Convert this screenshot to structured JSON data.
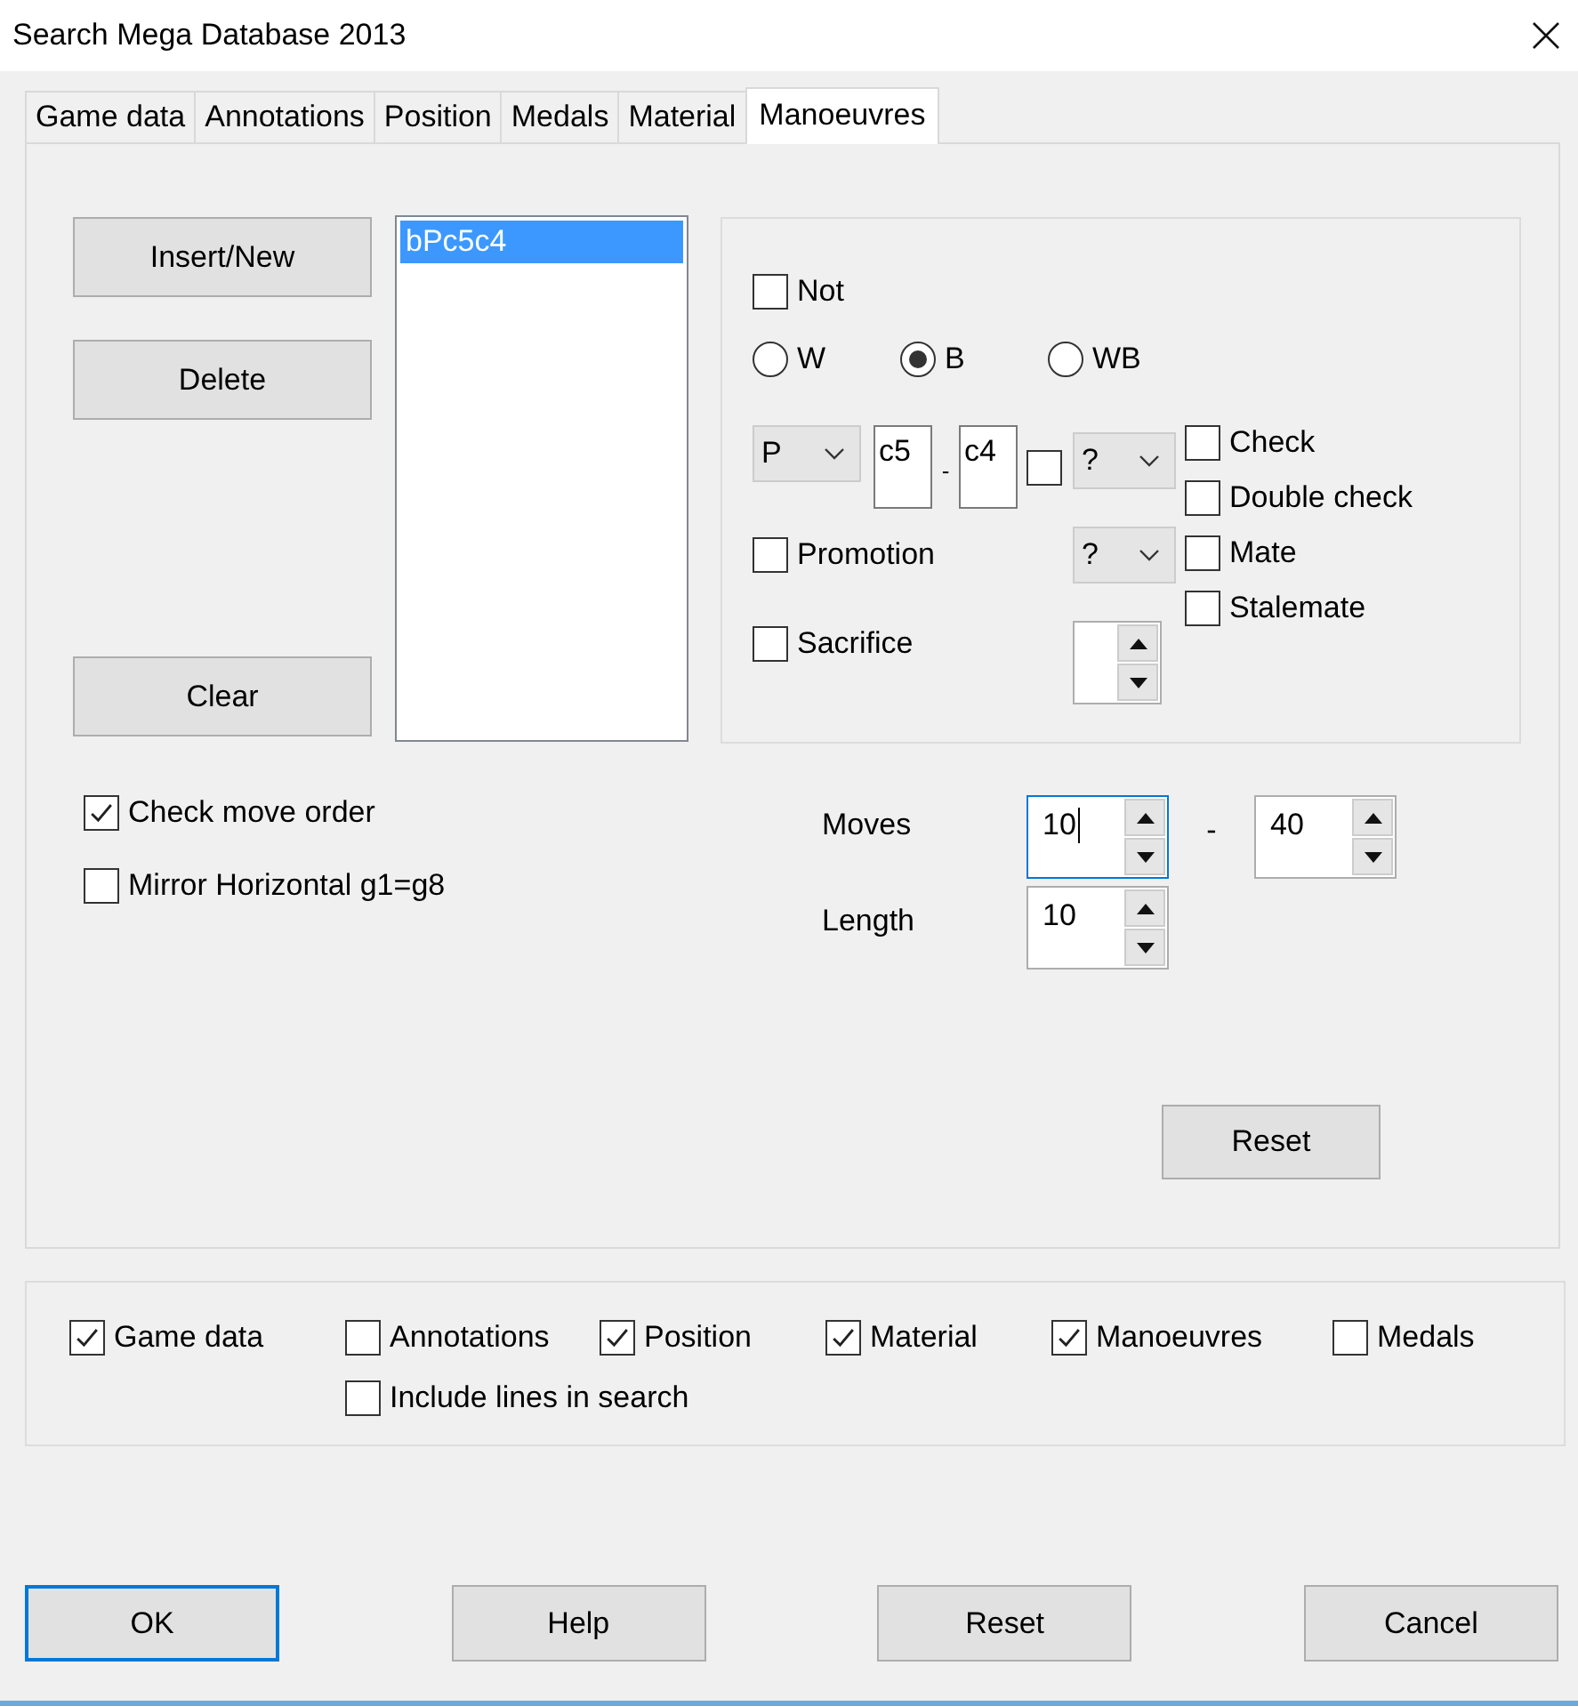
{
  "window": {
    "title": "Search Mega Database 2013"
  },
  "tabs": [
    {
      "label": "Game data",
      "selected": false
    },
    {
      "label": "Annotations",
      "selected": false
    },
    {
      "label": "Position",
      "selected": false
    },
    {
      "label": "Medals",
      "selected": false
    },
    {
      "label": "Material",
      "selected": false
    },
    {
      "label": "Manoeuvres",
      "selected": true
    }
  ],
  "manoeuvres": {
    "buttons": [
      "Insert/New",
      "Delete",
      "Clear"
    ],
    "list": [
      {
        "text": "bPc5c4",
        "selected": true
      }
    ],
    "criteria": {
      "not": {
        "label": "Not",
        "checked": false
      },
      "side": [
        {
          "label": "W",
          "selected": false
        },
        {
          "label": "B",
          "selected": true
        },
        {
          "label": "WB",
          "selected": false
        }
      ],
      "piece": "P",
      "from": "c5",
      "separator": "-",
      "to": "c4",
      "capture": {
        "checked": false,
        "value": "?"
      },
      "promotion": {
        "label": "Promotion",
        "checked": false,
        "value": "?"
      },
      "sacrifice": {
        "label": "Sacrifice",
        "checked": false
      },
      "checks": [
        {
          "label": "Check",
          "checked": false
        },
        {
          "label": "Double check",
          "checked": false
        },
        {
          "label": "Mate",
          "checked": false
        },
        {
          "label": "Stalemate",
          "checked": false
        }
      ]
    },
    "options": [
      {
        "label": "Check move order",
        "checked": true
      },
      {
        "label": "Mirror Horizontal g1=g8",
        "checked": false
      }
    ],
    "moves": {
      "label": "Moves",
      "from": "10",
      "from_focused": true,
      "separator": "-",
      "to": "40"
    },
    "length": {
      "label": "Length",
      "value": "10"
    },
    "reset": "Reset"
  },
  "search_in": [
    {
      "label": "Game data",
      "checked": true
    },
    {
      "label": "Annotations",
      "checked": false
    },
    {
      "label": "Position",
      "checked": true
    },
    {
      "label": "Material",
      "checked": true
    },
    {
      "label": "Manoeuvres",
      "checked": true
    },
    {
      "label": "Medals",
      "checked": false
    },
    {
      "label": "Include lines in search",
      "checked": false
    }
  ],
  "buttons": [
    {
      "label": "OK",
      "default": true
    },
    {
      "label": "Help",
      "default": false
    },
    {
      "label": "Reset",
      "default": false
    },
    {
      "label": "Cancel",
      "default": false
    }
  ]
}
